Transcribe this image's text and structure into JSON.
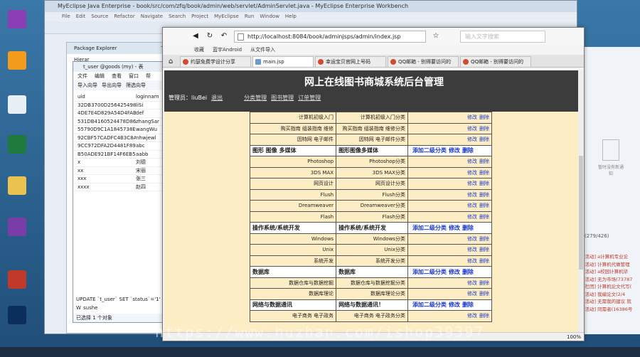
{
  "eclipse": {
    "title": "MyEclipse Java Enterprise - book/src/com/zfq/book/admin/web/servlet/AdminServlet.java - MyEclipse Enterprise Workbench",
    "menu": [
      "File",
      "Edit",
      "Source",
      "Refactor",
      "Navigate",
      "Search",
      "Project",
      "MyEclipse",
      "Run",
      "Window",
      "Help"
    ],
    "package_explorer_tab": "Package Explorer",
    "type_hierarchy_tab": "Type Hierar"
  },
  "dbwin": {
    "title": "t_user @goods (my) - 表",
    "menu": [
      "文件",
      "编辑",
      "查看",
      "窗口",
      "帮"
    ],
    "tools": [
      "导入向导",
      "导出向导",
      "筛选向导"
    ],
    "rows": [
      {
        "c1": "uid",
        "c2": "loginnam"
      },
      {
        "c1": "32DB3700D2564254982B",
        "c2": "liSi"
      },
      {
        "c1": "4DE7E4D829A54D4FAB1",
        "c2": "def"
      },
      {
        "c1": "531DB4160524478D86F8",
        "c2": "zhangSar"
      },
      {
        "c1": "55790D9C1A1845738E5D",
        "c2": "wangWu"
      },
      {
        "c1": "92CBF57CADFC4B3C8A71",
        "c2": "nhwjewl"
      },
      {
        "c1": "9CC972DFA2D4481F8904",
        "c2": "abc"
      },
      {
        "c1": "B50ADE921BF14F6EB533",
        "c2": "aabb"
      },
      {
        "c1": "x",
        "c2": "刘德"
      },
      {
        "c1": "xx",
        "c2": "宋丽"
      },
      {
        "c1": "xxx",
        "c2": "张三"
      },
      {
        "c1": "xxxx",
        "c2": "赵四"
      }
    ],
    "sql": "UPDATE `t_user` SET `status`='1' W",
    "node": "sushe",
    "status": "已选择 1 个对象"
  },
  "browser": {
    "url": "http://localhost:8084/book/adminjsps/admin/index.jsp",
    "search_placeholder": "输入文字搜索",
    "bookmarks": [
      "收藏",
      "蓝宇Android",
      "从文件导入"
    ],
    "tabs": [
      "约瑟免费学设计分享",
      "main.jsp",
      "幸运宝贝官网上号码",
      "QQ邮箱 - 别得要访问的",
      "QQ邮箱 - 别得要访问的"
    ],
    "zoom": "100%"
  },
  "admin": {
    "title": "网上在线图书商城系统后台管理",
    "user_label": "管理员：liuBei",
    "logout": "退出",
    "nav": [
      "分类管理",
      "图书管理",
      "订单管理"
    ]
  },
  "categories": [
    {
      "type": "sub",
      "name": "计算机初级入门",
      "sub": "计算机初级入门分类",
      "edit": "修改",
      "del": "删除"
    },
    {
      "type": "sub",
      "name": "购买指南 组装指南 维修",
      "sub": "购买指南 组装指南 维修分类",
      "edit": "修改",
      "del": "删除"
    },
    {
      "type": "sub",
      "name": "因特网 电子邮件",
      "sub": "因特网 电子邮件分类",
      "edit": "修改",
      "del": "删除"
    },
    {
      "type": "top",
      "name": "图形 图像 多媒体",
      "sub": "图形图像多媒体",
      "add": "添加二级分类",
      "edit": "修改",
      "del": "删除"
    },
    {
      "type": "sub",
      "name": "Photoshop",
      "sub": "Photoshop分类",
      "edit": "修改",
      "del": "删除"
    },
    {
      "type": "sub",
      "name": "3DS MAX",
      "sub": "3DS MAX分类",
      "edit": "修改",
      "del": "删除"
    },
    {
      "type": "sub",
      "name": "网页设计",
      "sub": "网页设计分类",
      "edit": "修改",
      "del": "删除"
    },
    {
      "type": "sub",
      "name": "Flush",
      "sub": "Flush分类",
      "edit": "修改",
      "del": "删除"
    },
    {
      "type": "sub",
      "name": "Dreamweaver",
      "sub": "Dreamweaver分类",
      "edit": "修改",
      "del": "删除"
    },
    {
      "type": "sub",
      "name": "Flash",
      "sub": "Flash分类",
      "edit": "修改",
      "del": "删除"
    },
    {
      "type": "top",
      "name": "操作系统/系统开发",
      "sub": "操作系统/系统开发",
      "add": "添加二级分类",
      "edit": "修改",
      "del": "删除"
    },
    {
      "type": "sub",
      "name": "Windows",
      "sub": "Windows分类",
      "edit": "修改",
      "del": "删除"
    },
    {
      "type": "sub",
      "name": "Unix",
      "sub": "Unix分类",
      "edit": "修改",
      "del": "删除"
    },
    {
      "type": "sub",
      "name": "系统开发",
      "sub": "系统开发分类",
      "edit": "修改",
      "del": "删除"
    },
    {
      "type": "top",
      "name": "数据库",
      "sub": "数据库",
      "add": "添加二级分类",
      "edit": "修改",
      "del": "删除"
    },
    {
      "type": "sub",
      "name": "数据仓库与数据挖掘",
      "sub": "数据仓库与数据挖掘分类",
      "edit": "修改",
      "del": "删除"
    },
    {
      "type": "sub",
      "name": "数据库理论",
      "sub": "数据库理论分类",
      "edit": "修改",
      "del": "删除"
    },
    {
      "type": "top",
      "name": "网络与数据通讯",
      "sub": "网络与数据通讯！",
      "add": "添加二级分类",
      "edit": "修改",
      "del": "删除"
    },
    {
      "type": "sub",
      "name": "电子商务 电子政务",
      "sub": "电子商务 电子政务分类",
      "edit": "修改",
      "del": "删除"
    }
  ],
  "right_panel": {
    "empty_text": "暂时没有新通知",
    "count": "(279/426)",
    "logs": [
      "[活动] a计算机专业论",
      "[活动] 计算机代做管理",
      "[活动] a校园计算机毕",
      "[活动] 无为市场(73787",
      "[社团] 计算机论文代写(",
      "[活动] 我编论文(2/4",
      "[活动] 无需我的建议 就",
      "[活动] 同需者(16386号"
    ]
  },
  "watermark": "https://www.huzhan.com/ishop39397",
  "colors": {
    "page_bg": "#fdedc4",
    "header_bg": "#3c3c3c",
    "link": "#1b39c9"
  }
}
